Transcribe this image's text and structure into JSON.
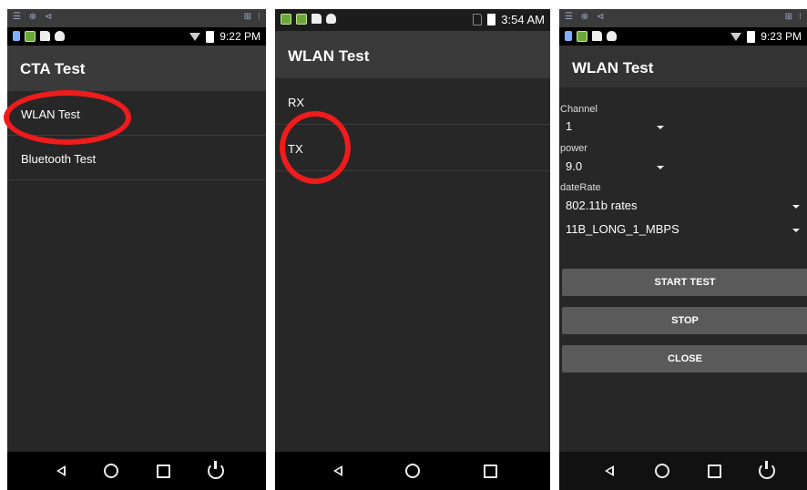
{
  "panels": [
    {
      "status_time": "9:22 PM",
      "title": "CTA Test",
      "items": [
        "WLAN Test",
        "Bluetooth Test"
      ]
    },
    {
      "status_time": "3:54 AM",
      "title": "WLAN Test",
      "items": [
        "RX",
        "TX"
      ]
    },
    {
      "status_time": "9:23 PM",
      "title": "WLAN Test",
      "fields": {
        "channel_label": "Channel",
        "channel_value": "1",
        "power_label": "power",
        "power_value": "9.0",
        "daterate_label": "dateRate",
        "rate_value": "802.11b rates",
        "mode_value": "11B_LONG_1_MBPS"
      },
      "buttons": {
        "start": "START TEST",
        "stop": "STOP",
        "close": "CLOSE"
      }
    }
  ],
  "icons": {
    "nav": [
      "back-icon",
      "home-icon",
      "recent-apps-icon",
      "power-icon"
    ]
  },
  "colors": {
    "highlight": "#ee1c1c",
    "app_bar": "#3a3a3a",
    "background": "#272727",
    "button": "#5a5a5a"
  }
}
